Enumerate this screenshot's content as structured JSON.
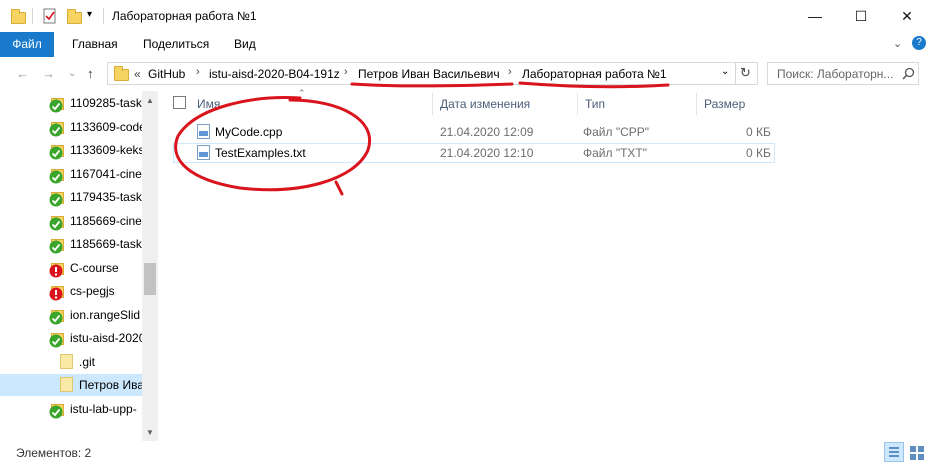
{
  "window": {
    "title": "Лабораторная работа №1",
    "controls": {
      "minimize": "—",
      "maximize": "☐",
      "close": "✕"
    }
  },
  "ribbon": {
    "tabs": [
      "Файл",
      "Главная",
      "Поделиться",
      "Вид"
    ],
    "collapse_glyph": "⌄",
    "help_glyph": "?"
  },
  "address": {
    "overflow": "«",
    "crumbs": [
      "GitHub",
      "istu-aisd-2020-B04-191z",
      "Петров Иван Васильевич",
      "Лабораторная работа №1"
    ],
    "sep": "›",
    "dropdown_glyph": "⌄",
    "refresh_glyph": "↻"
  },
  "search": {
    "placeholder": "Поиск: Лабораторн...",
    "icon": "search-icon"
  },
  "nav": {
    "back": "←",
    "forward": "→",
    "recent": "⌄",
    "up": "↑"
  },
  "sidebar": {
    "items": [
      {
        "label": "1109285-taskn",
        "badge": "ok"
      },
      {
        "label": "1133609-code",
        "badge": "ok"
      },
      {
        "label": "1133609-keks",
        "badge": "ok"
      },
      {
        "label": "1167041-cine",
        "badge": "ok"
      },
      {
        "label": "1179435-taskn",
        "badge": "ok"
      },
      {
        "label": "1185669-cine",
        "badge": "ok"
      },
      {
        "label": "1185669-taskn",
        "badge": "ok"
      },
      {
        "label": "C-course",
        "badge": "error"
      },
      {
        "label": "cs-pegjs",
        "badge": "error"
      },
      {
        "label": "ion.rangeSlid",
        "badge": "ok"
      },
      {
        "label": "istu-aisd-2020",
        "badge": "ok"
      },
      {
        "label": ".git",
        "badge": "folder"
      },
      {
        "label": "Петров Ива",
        "badge": "folder",
        "selected": true
      },
      {
        "label": "istu-lab-upp-",
        "badge": "ok"
      }
    ]
  },
  "columns": {
    "name": "Имя",
    "modified": "Дата изменения",
    "type": "Тип",
    "size": "Размер"
  },
  "files": [
    {
      "name": "MyCode.cpp",
      "modified": "21.04.2020 12:09",
      "type": "Файл \"CPP\"",
      "size": "0 КБ"
    },
    {
      "name": "TestExamples.txt",
      "modified": "21.04.2020 12:10",
      "type": "Файл \"TXT\"",
      "size": "0 КБ"
    }
  ],
  "status": {
    "items_count": "Элементов: 2"
  },
  "colors": {
    "accent": "#1979ca",
    "selection": "#cce8ff",
    "annotation": "#d9141c"
  }
}
